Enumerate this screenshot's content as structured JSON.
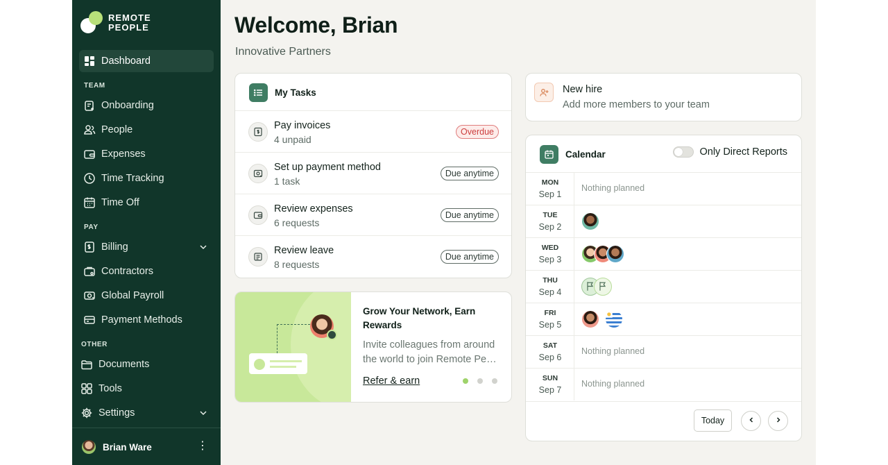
{
  "brand": {
    "line1": "REMOTE",
    "line2": "PEOPLE",
    "colors": {
      "sidebar": "#11362a",
      "accent": "#b8e07a"
    }
  },
  "sidebar": {
    "dashboard": "Dashboard",
    "sections": {
      "team": "TEAM",
      "pay": "PAY",
      "other": "OTHER"
    },
    "team_items": [
      "Onboarding",
      "People",
      "Expenses",
      "Time Tracking",
      "Time Off"
    ],
    "pay_items": [
      "Billing",
      "Contractors",
      "Global Payroll",
      "Payment Methods"
    ],
    "other_items": [
      "Documents",
      "Tools",
      "Settings"
    ],
    "user": {
      "name": "Brian Ware"
    }
  },
  "header": {
    "title": "Welcome, Brian",
    "subtitle": "Innovative Partners"
  },
  "tasks": {
    "title": "My Tasks",
    "items": [
      {
        "title": "Pay invoices",
        "sub": "4 unpaid",
        "badge": "Overdue",
        "icon": "invoice-icon"
      },
      {
        "title": "Set up payment method",
        "sub": "1 task",
        "badge": "Due anytime",
        "icon": "payment-method-icon"
      },
      {
        "title": "Review expenses",
        "sub": "6 requests",
        "badge": "Due anytime",
        "icon": "wallet-icon"
      },
      {
        "title": "Review leave",
        "sub": "8 requests",
        "badge": "Due anytime",
        "icon": "leave-icon"
      }
    ]
  },
  "referral": {
    "title": "Grow Your Network, Earn Rewards",
    "body_line1": "Invite colleagues from around",
    "body_line2": "the world to join Remote Peo…",
    "link": "Refer & earn"
  },
  "new_hire": {
    "title": "New hire",
    "subtitle": "Add more members to your team"
  },
  "calendar": {
    "title": "Calendar",
    "toggle_label": "Only Direct Reports",
    "days": [
      {
        "dow": "MON",
        "date": "Sep 1",
        "note": "Nothing planned",
        "avatars": []
      },
      {
        "dow": "TUE",
        "date": "Sep 2",
        "note": "",
        "avatars": [
          "person"
        ]
      },
      {
        "dow": "WED",
        "date": "Sep 3",
        "note": "",
        "avatars": [
          "person",
          "person",
          "person"
        ]
      },
      {
        "dow": "THU",
        "date": "Sep 4",
        "note": "",
        "avatars": [
          "flag",
          "flag"
        ]
      },
      {
        "dow": "FRI",
        "date": "Sep 5",
        "note": "",
        "avatars": [
          "person",
          "uruguay-flag"
        ]
      },
      {
        "dow": "SAT",
        "date": "Sep 6",
        "note": "Nothing planned",
        "avatars": []
      },
      {
        "dow": "SUN",
        "date": "Sep 7",
        "note": "Nothing planned",
        "avatars": []
      }
    ],
    "today_label": "Today"
  }
}
